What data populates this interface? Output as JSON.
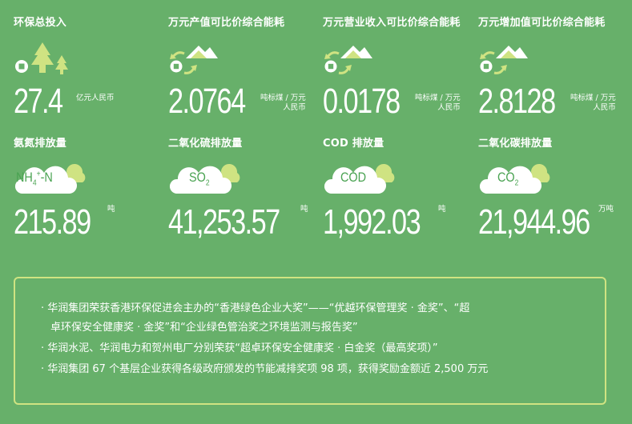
{
  "metrics_top": [
    {
      "label": "环保总投入",
      "value": "27.4",
      "unit_line1": "亿元人民币",
      "unit_line2": ""
    },
    {
      "label": "万元产值可比价综合能耗",
      "value": "2.0764",
      "unit_line1": "吨标煤 / 万元",
      "unit_line2": "人民币"
    },
    {
      "label": "万元营业收入可比价综合能耗",
      "value": "0.0178",
      "unit_line1": "吨标煤 / 万元",
      "unit_line2": "人民币"
    },
    {
      "label": "万元增加值可比价综合能耗",
      "value": "2.8128",
      "unit_line1": "吨标煤 / 万元",
      "unit_line2": "人民币"
    }
  ],
  "metrics_bottom": [
    {
      "label": "氨氮排放量",
      "value": "215.89",
      "unit": "吨",
      "icon_text": "NH4+-N"
    },
    {
      "label": "二氧化硫排放量",
      "value": "41,253.57",
      "unit": "吨",
      "icon_text": "SO2"
    },
    {
      "label": "COD 排放量",
      "value": "1,992.03",
      "unit": "吨",
      "icon_text": "COD"
    },
    {
      "label": "二氧化碳排放量",
      "value": "21,944.96",
      "unit": "万吨",
      "icon_text": "CO2"
    }
  ],
  "icons": {
    "investment": "coin-trees-icon",
    "energy": "recycle-mountain-icon",
    "emission": "cloud-icon"
  },
  "colors": {
    "background": "#67b06a",
    "accent_yellow": "#cfe382",
    "text": "#ffffff"
  },
  "notes": [
    "· 华润集团荣获香港环保促进会主办的“香港绿色企业大奖”——“优越环保管理奖 · 金奖”、“超",
    "卓环保安全健康奖 · 金奖”和“企业绿色管治奖之环境监测与报告奖”",
    "· 华润水泥、华润电力和贺州电厂分别荣获“超卓环保安全健康奖 · 白金奖（最高奖项）”",
    "· 华润集团 67 个基层企业获得各级政府颁发的节能减排奖项 98 项，获得奖励金额近 2,500 万元"
  ]
}
